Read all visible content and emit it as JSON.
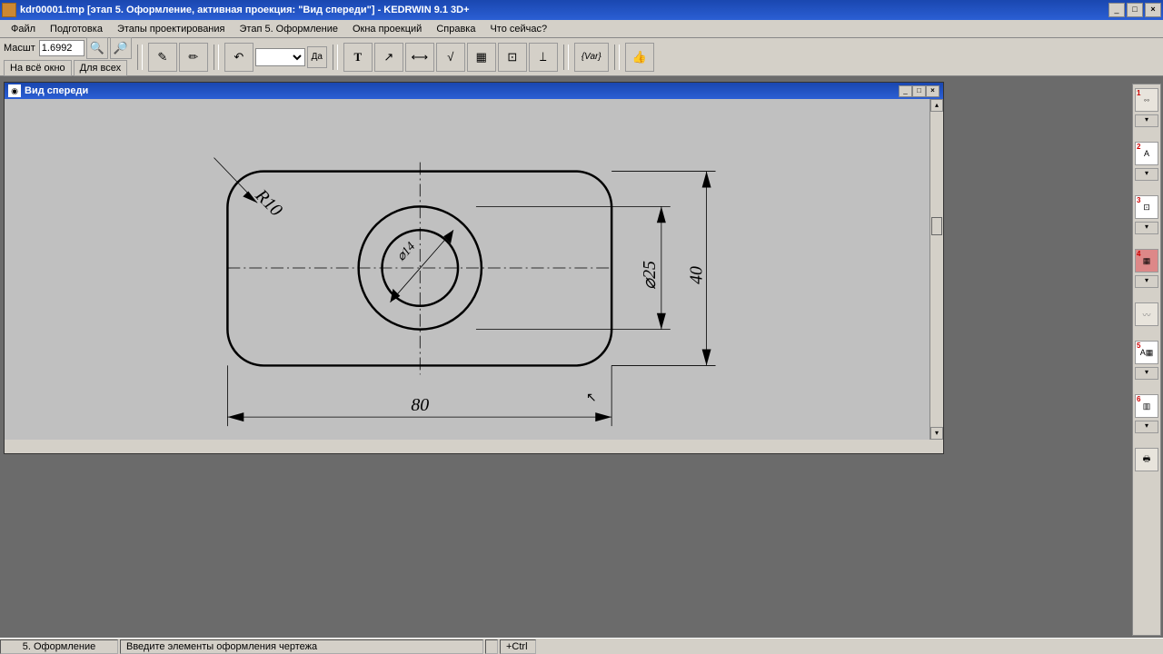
{
  "window": {
    "title": "kdr00001.tmp [этап 5. Оформление, активная проекция: \"Вид спереди\"] - KEDRWIN 9.1 3D+"
  },
  "menu": {
    "items": [
      "Файл",
      "Подготовка",
      "Этапы проектирования",
      "Этап 5. Оформление",
      "Окна проекций",
      "Справка",
      "Что сейчас?"
    ]
  },
  "toolbar": {
    "scale_label": "Масшт",
    "scale_value": "1.6992",
    "fit_window": "На всё окно",
    "for_all": "Для всех",
    "da": "Да",
    "var": "{Var}"
  },
  "docwin": {
    "title": "Вид спереди"
  },
  "drawing": {
    "dim_width": "80",
    "dim_height": "40",
    "dim_dia": "⌀25",
    "dim_radius": "R10",
    "dim_small": "⌀14"
  },
  "status": {
    "stage": "5. Оформление",
    "hint": "Введите элементы оформления чертежа",
    "modifier": "+Ctrl"
  },
  "right_tools": [
    "1",
    "2",
    "3",
    "4",
    "5",
    "6"
  ]
}
